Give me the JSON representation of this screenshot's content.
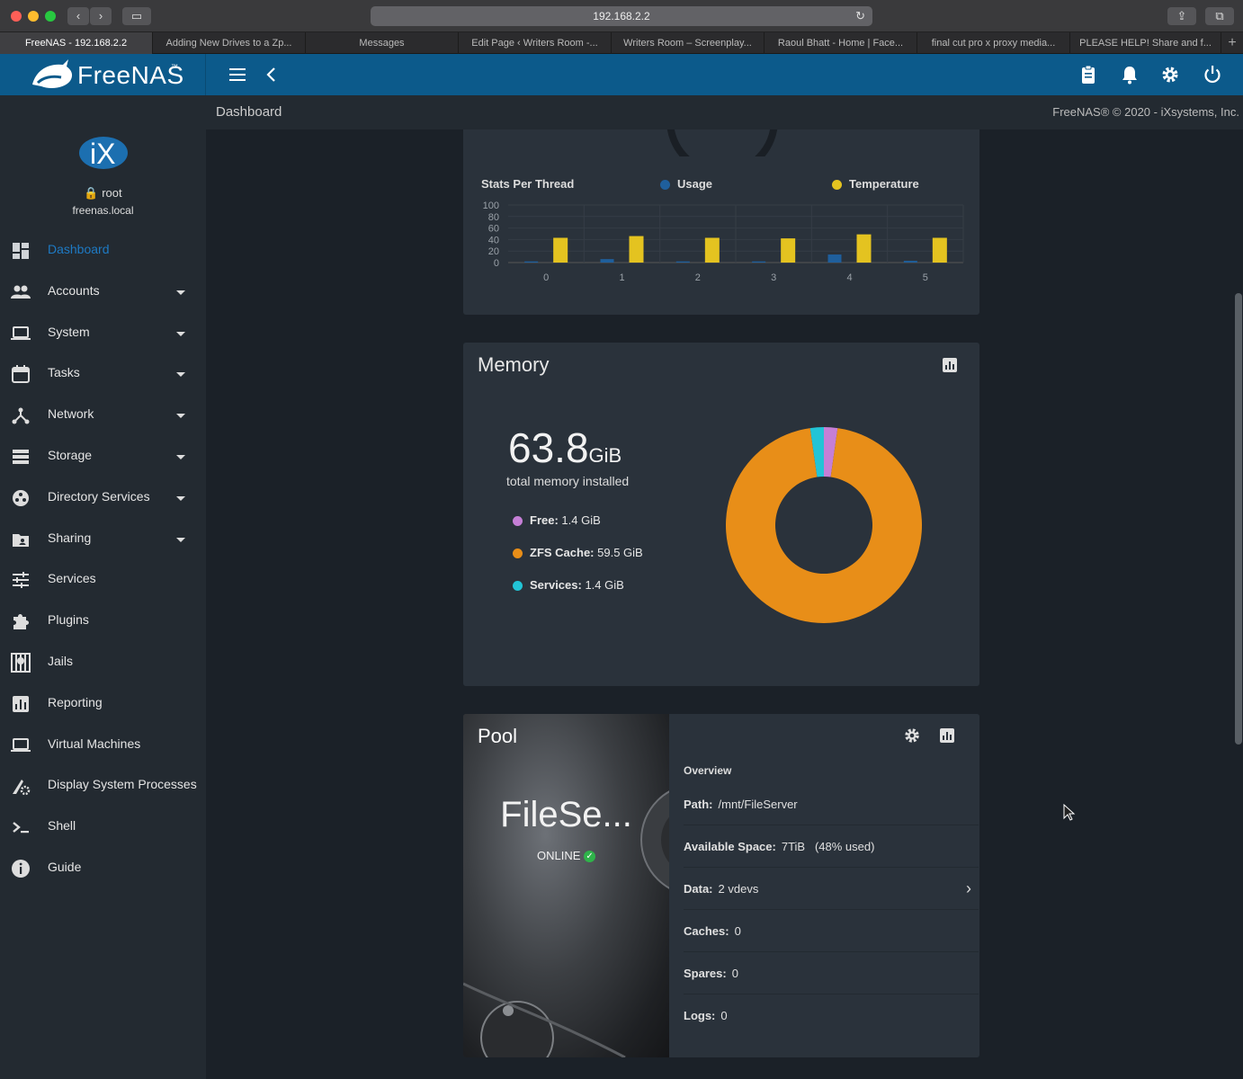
{
  "browser": {
    "url": "192.168.2.2",
    "tabs": [
      "FreeNAS - 192.168.2.2",
      "Adding New Drives to a Zp...",
      "Messages",
      "Edit Page ‹ Writers Room -...",
      "Writers Room – Screenplay...",
      "Raoul Bhatt - Home | Face...",
      "final cut pro x proxy media...",
      "PLEASE HELP! Share and f..."
    ]
  },
  "app": {
    "brand": "FreeNAS",
    "breadcrumb": "Dashboard",
    "copyright": "FreeNAS® © 2020 - iXsystems, Inc."
  },
  "user": {
    "name": "root",
    "host": "freenas.local"
  },
  "sidebar": {
    "items": [
      {
        "label": "Dashboard",
        "icon": "dashboard-icon",
        "expand": false
      },
      {
        "label": "Accounts",
        "icon": "accounts-icon",
        "expand": true
      },
      {
        "label": "System",
        "icon": "system-icon",
        "expand": true
      },
      {
        "label": "Tasks",
        "icon": "calendar-icon",
        "expand": true
      },
      {
        "label": "Network",
        "icon": "network-icon",
        "expand": true
      },
      {
        "label": "Storage",
        "icon": "storage-icon",
        "expand": true
      },
      {
        "label": "Directory Services",
        "icon": "directory-icon",
        "expand": true
      },
      {
        "label": "Sharing",
        "icon": "folder-share-icon",
        "expand": true
      },
      {
        "label": "Services",
        "icon": "sliders-icon",
        "expand": false
      },
      {
        "label": "Plugins",
        "icon": "puzzle-icon",
        "expand": false
      },
      {
        "label": "Jails",
        "icon": "jail-icon",
        "expand": false
      },
      {
        "label": "Reporting",
        "icon": "chart-icon",
        "expand": false
      },
      {
        "label": "Virtual Machines",
        "icon": "laptop-icon",
        "expand": false
      },
      {
        "label": "Display System Processes",
        "icon": "processes-icon",
        "expand": false
      },
      {
        "label": "Shell",
        "icon": "shell-icon",
        "expand": false
      },
      {
        "label": "Guide",
        "icon": "info-icon",
        "expand": false
      }
    ]
  },
  "cpu": {
    "chart_title": "Stats Per Thread",
    "legend_usage": "Usage",
    "legend_temp": "Temperature",
    "colors": {
      "usage": "#1f5f9c",
      "temperature": "#e4c320"
    }
  },
  "memory": {
    "title": "Memory",
    "total_value": "63.8",
    "total_unit": "GiB",
    "total_label": "total memory installed",
    "legend": [
      {
        "label": "Free:",
        "value": "1.4 GiB",
        "color": "#c57fd6"
      },
      {
        "label": "ZFS Cache:",
        "value": "59.5 GiB",
        "color": "#e88e18"
      },
      {
        "label": "Services:",
        "value": "1.4 GiB",
        "color": "#22c4d6"
      }
    ]
  },
  "pool": {
    "title": "Pool",
    "name": "FileSe...",
    "status": "ONLINE",
    "overview": "Overview",
    "rows": [
      {
        "label": "Path:",
        "value": "/mnt/FileServer"
      },
      {
        "label": "Available Space:",
        "value": "7TiB   (48% used)"
      },
      {
        "label": "Data:",
        "value": "2 vdevs"
      },
      {
        "label": "Caches:",
        "value": "0"
      },
      {
        "label": "Spares:",
        "value": "0"
      },
      {
        "label": "Logs:",
        "value": "0"
      }
    ]
  },
  "chart_data": [
    {
      "type": "bar",
      "title": "Stats Per Thread",
      "categories": [
        "0",
        "1",
        "2",
        "3",
        "4",
        "5"
      ],
      "ylim": [
        0,
        100
      ],
      "yticks": [
        0,
        20,
        40,
        60,
        80,
        100
      ],
      "series": [
        {
          "name": "Usage",
          "values": [
            2,
            6,
            2,
            2,
            14,
            3
          ]
        },
        {
          "name": "Temperature",
          "values": [
            43,
            46,
            43,
            42,
            49,
            43
          ]
        }
      ]
    },
    {
      "type": "pie",
      "title": "Memory",
      "categories": [
        "Free",
        "ZFS Cache",
        "Services"
      ],
      "values": [
        1.4,
        59.5,
        1.4
      ]
    }
  ]
}
